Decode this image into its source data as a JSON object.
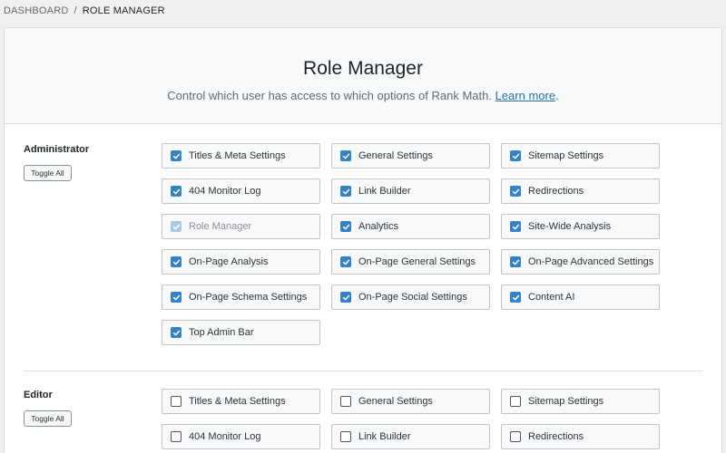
{
  "breadcrumb": {
    "dashboard": "DASHBOARD",
    "separator": "/",
    "current": "ROLE MANAGER"
  },
  "header": {
    "title": "Role Manager",
    "description": "Control which user has access to which options of Rank Math.",
    "learn_more": "Learn more",
    "period": "."
  },
  "colors": {
    "accent": "#3582c4",
    "link": "#2271b1"
  },
  "icons": {
    "checked": "check-icon",
    "unchecked": "empty-box"
  },
  "roles": [
    {
      "name": "Administrator",
      "toggle_label": "Toggle All",
      "capabilities": [
        {
          "label": "Titles & Meta Settings",
          "checked": true,
          "disabled": false
        },
        {
          "label": "General Settings",
          "checked": true,
          "disabled": false
        },
        {
          "label": "Sitemap Settings",
          "checked": true,
          "disabled": false
        },
        {
          "label": "404 Monitor Log",
          "checked": true,
          "disabled": false
        },
        {
          "label": "Link Builder",
          "checked": true,
          "disabled": false
        },
        {
          "label": "Redirections",
          "checked": true,
          "disabled": false
        },
        {
          "label": "Role Manager",
          "checked": true,
          "disabled": true
        },
        {
          "label": "Analytics",
          "checked": true,
          "disabled": false
        },
        {
          "label": "Site-Wide Analysis",
          "checked": true,
          "disabled": false
        },
        {
          "label": "On-Page Analysis",
          "checked": true,
          "disabled": false
        },
        {
          "label": "On-Page General Settings",
          "checked": true,
          "disabled": false
        },
        {
          "label": "On-Page Advanced Settings",
          "checked": true,
          "disabled": false
        },
        {
          "label": "On-Page Schema Settings",
          "checked": true,
          "disabled": false
        },
        {
          "label": "On-Page Social Settings",
          "checked": true,
          "disabled": false
        },
        {
          "label": "Content AI",
          "checked": true,
          "disabled": false
        },
        {
          "label": "Top Admin Bar",
          "checked": true,
          "disabled": false
        }
      ]
    },
    {
      "name": "Editor",
      "toggle_label": "Toggle All",
      "capabilities": [
        {
          "label": "Titles & Meta Settings",
          "checked": false,
          "disabled": false
        },
        {
          "label": "General Settings",
          "checked": false,
          "disabled": false
        },
        {
          "label": "Sitemap Settings",
          "checked": false,
          "disabled": false
        },
        {
          "label": "404 Monitor Log",
          "checked": false,
          "disabled": false
        },
        {
          "label": "Link Builder",
          "checked": false,
          "disabled": false
        },
        {
          "label": "Redirections",
          "checked": false,
          "disabled": false
        }
      ]
    }
  ]
}
